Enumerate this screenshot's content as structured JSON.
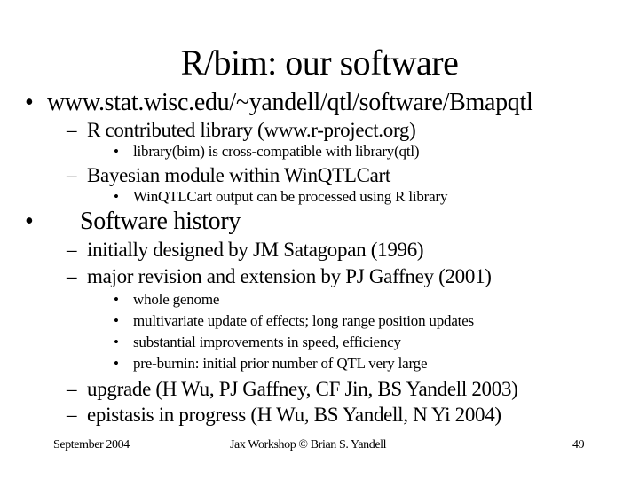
{
  "slide": {
    "title": "R/bim: our software",
    "bullet1": {
      "text": "www.stat.wisc.edu/~yandell/qtl/software/Bmapqtl",
      "sub": [
        {
          "text": "R contributed library (www.r-project.org)",
          "sub": [
            "library(bim) is cross-compatible with library(qtl)"
          ]
        },
        {
          "text": "Bayesian module within WinQTLCart",
          "sub": [
            "WinQTLCart output can be processed using R library"
          ]
        }
      ]
    },
    "bullet2": {
      "text": "Software history",
      "sub": [
        "initially designed by JM Satagopan (1996)",
        "major revision and extension by PJ Gaffney (2001)"
      ],
      "subsub": [
        "whole genome",
        "multivariate update of effects; long range position updates",
        "substantial improvements in speed, efficiency",
        "pre-burnin: initial prior number of QTL very large"
      ],
      "sub2": [
        "upgrade (H Wu, PJ Gaffney, CF Jin, BS Yandell 2003)",
        "epistasis in progress (H Wu, BS Yandell, N Yi 2004)"
      ]
    },
    "glyphs": {
      "bullet": "•",
      "dash": "–"
    }
  },
  "footer": {
    "date": "September 2004",
    "center": "Jax Workshop © Brian S. Yandell",
    "page": "49"
  }
}
